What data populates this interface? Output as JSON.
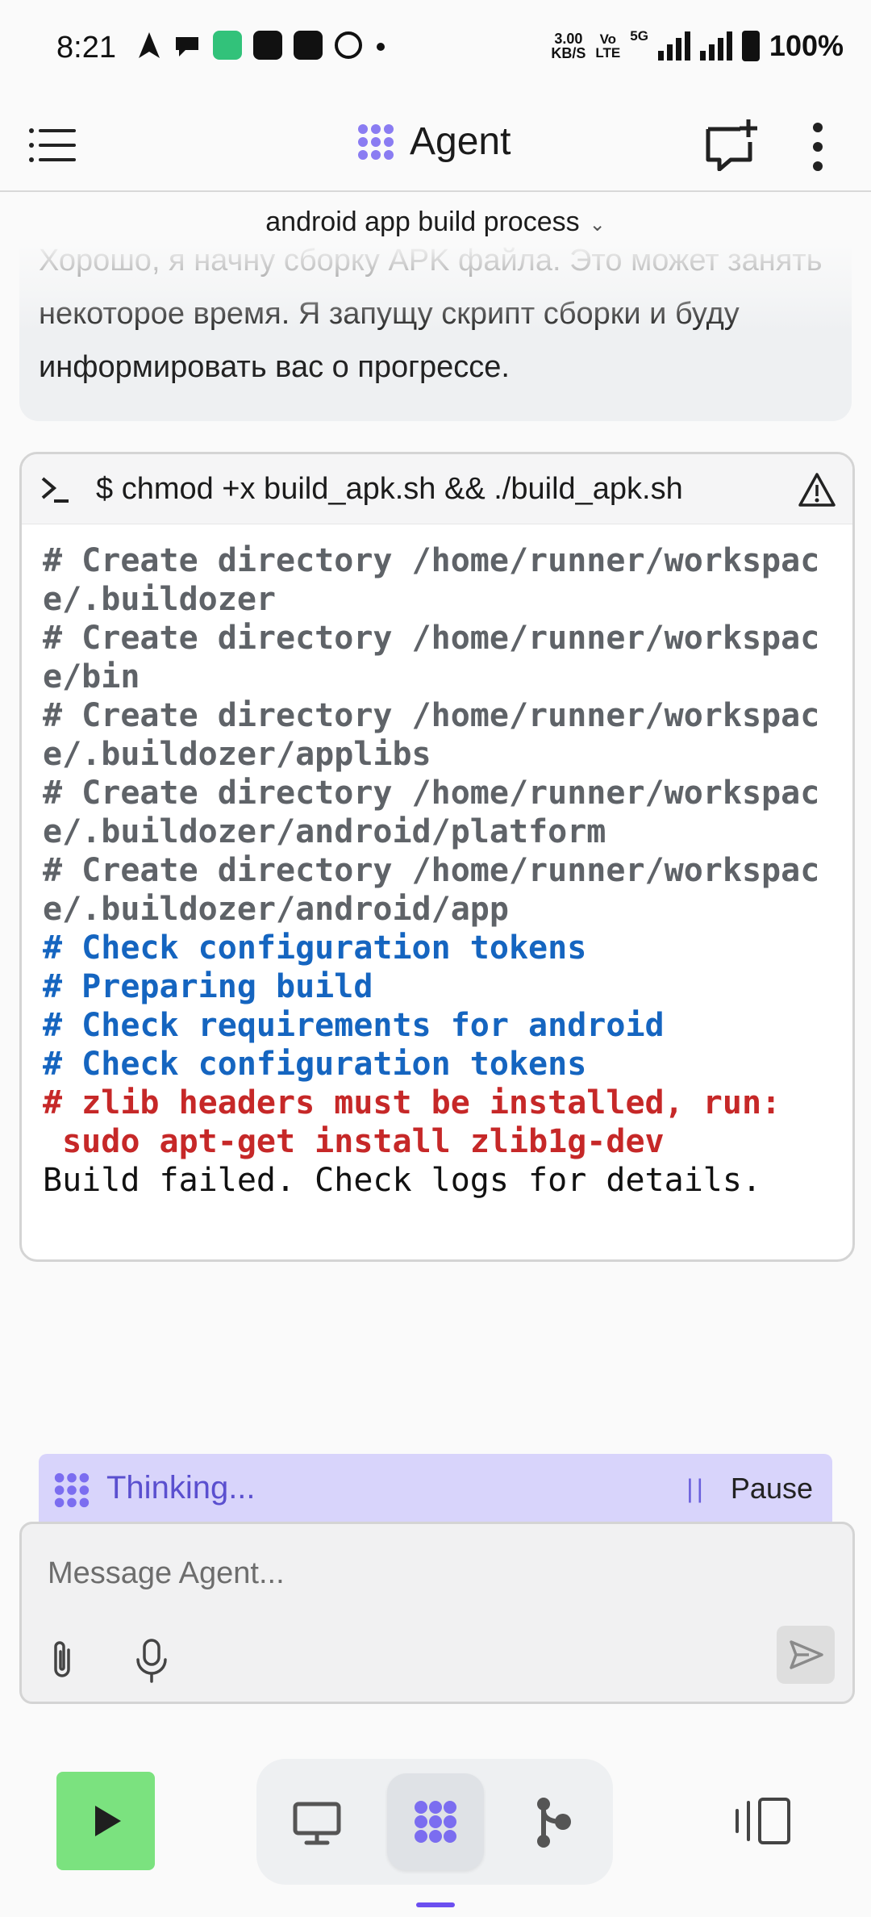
{
  "status_bar": {
    "time": "8:21",
    "net_speed_value": "3.00",
    "net_speed_unit": "KB/S",
    "vo_label": "Vo",
    "lte_label": "LTE",
    "fiveg_label": "5G",
    "battery": "100%"
  },
  "header": {
    "title": "Agent"
  },
  "thread": {
    "title": "android app build process"
  },
  "message": {
    "text": "Хорошо, я начну сборку APK файла. Это может занять некоторое время. Я запущу скрипт сборки и буду информировать вас о прогрессе."
  },
  "terminal": {
    "command": "$ chmod +x build_apk.sh && ./build_apk.sh",
    "lines": [
      {
        "text": "# Create directory /home/runner/workspace/.buildozer",
        "style": "gray"
      },
      {
        "text": "# Create directory /home/runner/workspace/bin",
        "style": "gray"
      },
      {
        "text": "# Create directory /home/runner/workspace/.buildozer/applibs",
        "style": "gray"
      },
      {
        "text": "# Create directory /home/runner/workspace/.buildozer/android/platform",
        "style": "gray"
      },
      {
        "text": "# Create directory /home/runner/workspace/.buildozer/android/app",
        "style": "gray"
      },
      {
        "text": "# Check configuration tokens",
        "style": "blue"
      },
      {
        "text": "# Preparing build",
        "style": "blue"
      },
      {
        "text": "# Check requirements for android",
        "style": "blue"
      },
      {
        "text": "# Check configuration tokens",
        "style": "blue"
      },
      {
        "text": "# zlib headers must be installed, run:\n sudo apt-get install zlib1g-dev",
        "style": "red"
      },
      {
        "text": "Build failed. Check logs for details.",
        "style": "black"
      }
    ]
  },
  "thinking": {
    "label": "Thinking...",
    "pause_label": "Pause"
  },
  "composer": {
    "placeholder": "Message Agent..."
  },
  "icons": {
    "menu": "menu-icon",
    "agent_logo": "agent-logo-icon",
    "new_chat": "new-chat-icon",
    "more": "more-vertical-icon",
    "prompt": "terminal-prompt-icon",
    "warning": "warning-icon",
    "attach": "paperclip-icon",
    "mic": "microphone-icon",
    "send": "send-icon",
    "play": "play-icon",
    "preview": "monitor-icon",
    "agent_tab": "agent-tab-icon",
    "git": "git-branch-icon",
    "panel": "panel-toggle-icon"
  },
  "colors": {
    "accent": "#6c4ff0",
    "thinking_bg": "#d8d4fb",
    "run_button": "#7be27f",
    "log_blue": "#1565c0",
    "log_red": "#c62828",
    "log_gray": "#5f6368"
  }
}
